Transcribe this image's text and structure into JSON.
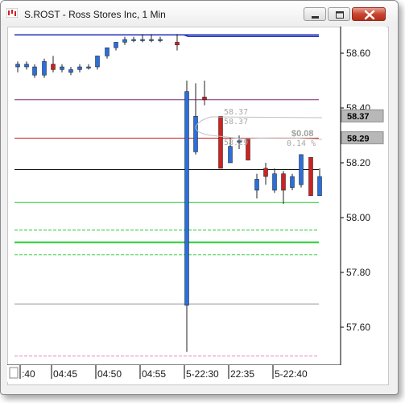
{
  "window": {
    "title": "S.ROST - Ross Stores Inc, 1 Min"
  },
  "colors": {
    "up_candle": "#2a6fdb",
    "down_candle": "#cc2222",
    "blue_line": "#1f2fb8",
    "purple_line": "#7a2a7a",
    "red_line": "#cc2222",
    "black_line": "#000000",
    "green_line": "#22cc33",
    "gray_line": "#9a9a9a",
    "pink_line": "#e58acb"
  },
  "price_axis": {
    "ticks": [
      "58.60",
      "58.40",
      "58.20",
      "58.00",
      "57.80",
      "57.60"
    ],
    "tags": [
      {
        "label": "58.37",
        "value": 58.37
      },
      {
        "label": "58.29",
        "value": 58.29
      }
    ]
  },
  "chart_overlay": {
    "upper_label": "58.37",
    "upper_label_2": "58.37",
    "mid_label": "58.29",
    "change_value": "$0.08",
    "change_pct": "0.14 %"
  },
  "time_axis": {
    "labels": [
      ":40",
      "04:45",
      "04:50",
      "04:55",
      "5-22:30",
      "22:35",
      "5-22:40"
    ]
  },
  "chart_data": {
    "type": "candlestick",
    "title": "S.ROST - Ross Stores Inc, 1 Min",
    "ylim": [
      57.5,
      58.7
    ],
    "candles": [
      {
        "o": 58.55,
        "h": 58.57,
        "l": 58.53,
        "c": 58.56
      },
      {
        "o": 58.55,
        "h": 58.57,
        "l": 58.54,
        "c": 58.56
      },
      {
        "o": 58.52,
        "h": 58.56,
        "l": 58.51,
        "c": 58.55
      },
      {
        "o": 58.52,
        "h": 58.58,
        "l": 58.51,
        "c": 58.57
      },
      {
        "o": 58.56,
        "h": 58.59,
        "l": 58.53,
        "c": 58.54
      },
      {
        "o": 58.54,
        "h": 58.56,
        "l": 58.53,
        "c": 58.55
      },
      {
        "o": 58.53,
        "h": 58.55,
        "l": 58.52,
        "c": 58.54
      },
      {
        "o": 58.54,
        "h": 58.56,
        "l": 58.53,
        "c": 58.55
      },
      {
        "o": 58.55,
        "h": 58.56,
        "l": 58.54,
        "c": 58.55
      },
      {
        "o": 58.55,
        "h": 58.59,
        "l": 58.54,
        "c": 58.59
      },
      {
        "o": 58.59,
        "h": 58.62,
        "l": 58.58,
        "c": 58.62
      },
      {
        "o": 58.62,
        "h": 58.64,
        "l": 58.61,
        "c": 58.64
      },
      {
        "o": 58.64,
        "h": 58.66,
        "l": 58.63,
        "c": 58.65
      },
      {
        "o": 58.65,
        "h": 58.66,
        "l": 58.64,
        "c": 58.65
      },
      {
        "o": 58.65,
        "h": 58.67,
        "l": 58.64,
        "c": 58.65
      },
      {
        "o": 58.65,
        "h": 58.67,
        "l": 58.64,
        "c": 58.65
      },
      {
        "o": 58.65,
        "h": 58.66,
        "l": 58.64,
        "c": 58.65
      },
      {
        "o": 58.64,
        "h": 58.67,
        "l": 58.61,
        "c": 58.63
      },
      {
        "o": 57.68,
        "h": 58.5,
        "l": 57.51,
        "c": 58.46
      },
      {
        "o": 58.24,
        "h": 58.49,
        "l": 58.23,
        "c": 58.37
      },
      {
        "o": 58.44,
        "h": 58.5,
        "l": 58.41,
        "c": 58.43
      },
      {
        "o": 58.37,
        "h": 58.37,
        "l": 58.18,
        "c": 58.18
      },
      {
        "o": 58.2,
        "h": 58.29,
        "l": 58.2,
        "c": 58.26
      },
      {
        "o": 58.28,
        "h": 58.3,
        "l": 58.25,
        "c": 58.28
      },
      {
        "o": 58.29,
        "h": 58.29,
        "l": 58.21,
        "c": 58.21
      },
      {
        "o": 58.1,
        "h": 58.16,
        "l": 58.07,
        "c": 58.14
      },
      {
        "o": 58.18,
        "h": 58.2,
        "l": 58.12,
        "c": 58.15
      },
      {
        "o": 58.1,
        "h": 58.18,
        "l": 58.09,
        "c": 58.16
      },
      {
        "o": 58.16,
        "h": 58.17,
        "l": 58.05,
        "c": 58.1
      },
      {
        "o": 58.11,
        "h": 58.16,
        "l": 58.1,
        "c": 58.15
      },
      {
        "o": 58.12,
        "h": 58.23,
        "l": 58.11,
        "c": 58.23
      },
      {
        "o": 58.22,
        "h": 58.22,
        "l": 58.08,
        "c": 58.08
      },
      {
        "o": 58.08,
        "h": 58.18,
        "l": 58.08,
        "c": 58.15
      }
    ],
    "levels": [
      {
        "value": 58.667,
        "color": "blue_line",
        "style": "solid",
        "width": 1.5
      },
      {
        "value": 58.43,
        "color": "purple_line",
        "style": "solid",
        "width": 1
      },
      {
        "value": 58.29,
        "color": "red_line",
        "style": "solid",
        "width": 1
      },
      {
        "value": 58.175,
        "color": "black_line",
        "style": "solid",
        "width": 1
      },
      {
        "value": 58.055,
        "color": "green_line",
        "style": "solid",
        "width": 1
      },
      {
        "value": 57.955,
        "color": "green_line",
        "style": "dashed",
        "width": 1
      },
      {
        "value": 57.91,
        "color": "green_line",
        "style": "solid",
        "width": 2
      },
      {
        "value": 57.865,
        "color": "green_line",
        "style": "dashed",
        "width": 1
      },
      {
        "value": 57.685,
        "color": "gray_line",
        "style": "solid",
        "width": 1
      },
      {
        "value": 57.495,
        "color": "pink_line",
        "style": "dashed",
        "width": 1
      }
    ]
  }
}
